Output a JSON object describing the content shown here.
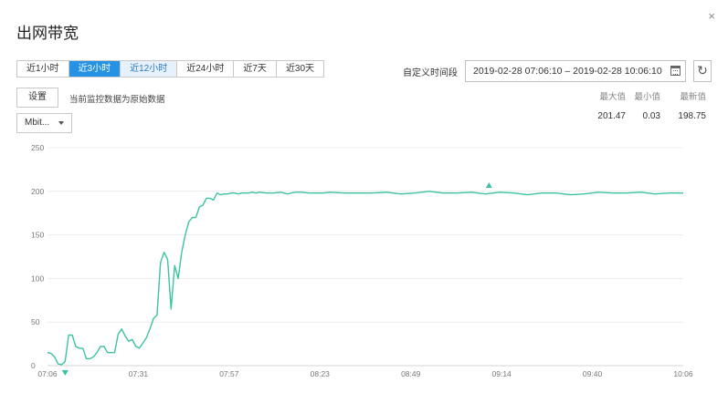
{
  "dialog": {
    "title": "出网带宽",
    "close_glyph": "×"
  },
  "time_ranges": [
    {
      "label": "近1小时",
      "state": "normal"
    },
    {
      "label": "近3小时",
      "state": "active"
    },
    {
      "label": "近12小时",
      "state": "hover"
    },
    {
      "label": "近24小时",
      "state": "normal"
    },
    {
      "label": "近7天",
      "state": "normal"
    },
    {
      "label": "近30天",
      "state": "normal"
    }
  ],
  "custom_range": {
    "label": "自定义时间段",
    "value": "2019-02-28 07:06:10 – 2019-02-28 10:06:10",
    "calendar_icon": "calendar-icon",
    "refresh_icon": "refresh-icon"
  },
  "settings": {
    "button_label": "设置",
    "note": "当前监控数据为原始数据"
  },
  "unit_select": {
    "value": "Mbit..."
  },
  "stats": {
    "max_label": "最大值",
    "max_value": "201.47",
    "min_label": "最小值",
    "min_value": "0.03",
    "latest_label": "最新值",
    "latest_value": "198.75"
  },
  "colors": {
    "accent": "#2592e6",
    "line": "#3cc3a3",
    "grid": "#ececec"
  },
  "chart_data": {
    "type": "line",
    "x_ticks": [
      "07:06",
      "07:31",
      "07:57",
      "08:23",
      "08:49",
      "09:14",
      "09:40",
      "10:06"
    ],
    "y_ticks": [
      "0",
      "50",
      "100",
      "150",
      "200",
      "250"
    ],
    "ylim": [
      0,
      250
    ],
    "grid": true,
    "x": [
      0,
      1,
      2,
      3,
      4,
      5,
      6,
      7,
      8,
      9,
      10,
      11,
      12,
      13,
      14,
      15,
      16,
      17,
      18,
      19,
      20,
      21,
      22,
      23,
      24,
      25,
      26,
      27,
      28,
      29,
      30,
      31,
      32,
      33,
      34,
      35,
      36,
      37,
      38,
      39,
      40,
      41,
      42,
      43,
      44,
      45,
      46,
      47,
      48,
      49,
      50,
      51,
      52,
      53,
      54,
      55,
      56,
      57,
      58,
      59,
      60,
      62,
      64,
      66,
      68,
      70,
      72,
      74,
      76,
      78,
      80,
      84,
      88,
      92,
      96,
      100,
      104,
      108,
      112,
      116,
      120,
      124,
      128,
      132,
      136,
      140,
      144,
      148,
      152,
      156,
      160,
      164,
      168,
      172,
      176,
      180
    ],
    "values": [
      15,
      14,
      10,
      2,
      1,
      5,
      35,
      35,
      22,
      20,
      20,
      8,
      8,
      10,
      15,
      22,
      22,
      15,
      15,
      15,
      36,
      42,
      34,
      28,
      30,
      22,
      20,
      26,
      32,
      42,
      54,
      58,
      118,
      130,
      122,
      65,
      115,
      100,
      130,
      150,
      165,
      170,
      170,
      182,
      184,
      192,
      192,
      190,
      198,
      196,
      197,
      197,
      198,
      198,
      197,
      198,
      198,
      198,
      199,
      198,
      199,
      198,
      198,
      199,
      197,
      199,
      199,
      198,
      198,
      198,
      199,
      198,
      198,
      198,
      199,
      197,
      198,
      200,
      198,
      198,
      199,
      197,
      199,
      198,
      196,
      198,
      198,
      196,
      197,
      199,
      198,
      198,
      199,
      197,
      198,
      198
    ],
    "markers": [
      {
        "type": "min",
        "x": 5
      },
      {
        "type": "max",
        "x": 125
      }
    ]
  }
}
